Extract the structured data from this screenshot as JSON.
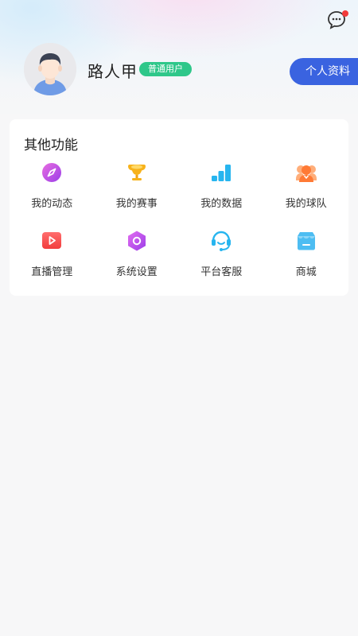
{
  "header": {
    "message_icon": "chat-bubble-icon",
    "unread_dot_color": "#f23a3a"
  },
  "profile": {
    "username": "路人甲",
    "user_type": "普通用户",
    "profile_button": "个人资料",
    "badge_color": "#2fc78a",
    "button_color": "#3a63e0"
  },
  "features": {
    "title": "其他功能",
    "items": [
      {
        "label": "我的动态",
        "icon": "compass-icon"
      },
      {
        "label": "我的赛事",
        "icon": "trophy-icon"
      },
      {
        "label": "我的数据",
        "icon": "bar-chart-icon"
      },
      {
        "label": "我的球队",
        "icon": "team-icon"
      },
      {
        "label": "直播管理",
        "icon": "play-icon"
      },
      {
        "label": "系统设置",
        "icon": "settings-icon"
      },
      {
        "label": "平台客服",
        "icon": "headset-icon"
      },
      {
        "label": "商城",
        "icon": "shop-icon"
      }
    ]
  }
}
